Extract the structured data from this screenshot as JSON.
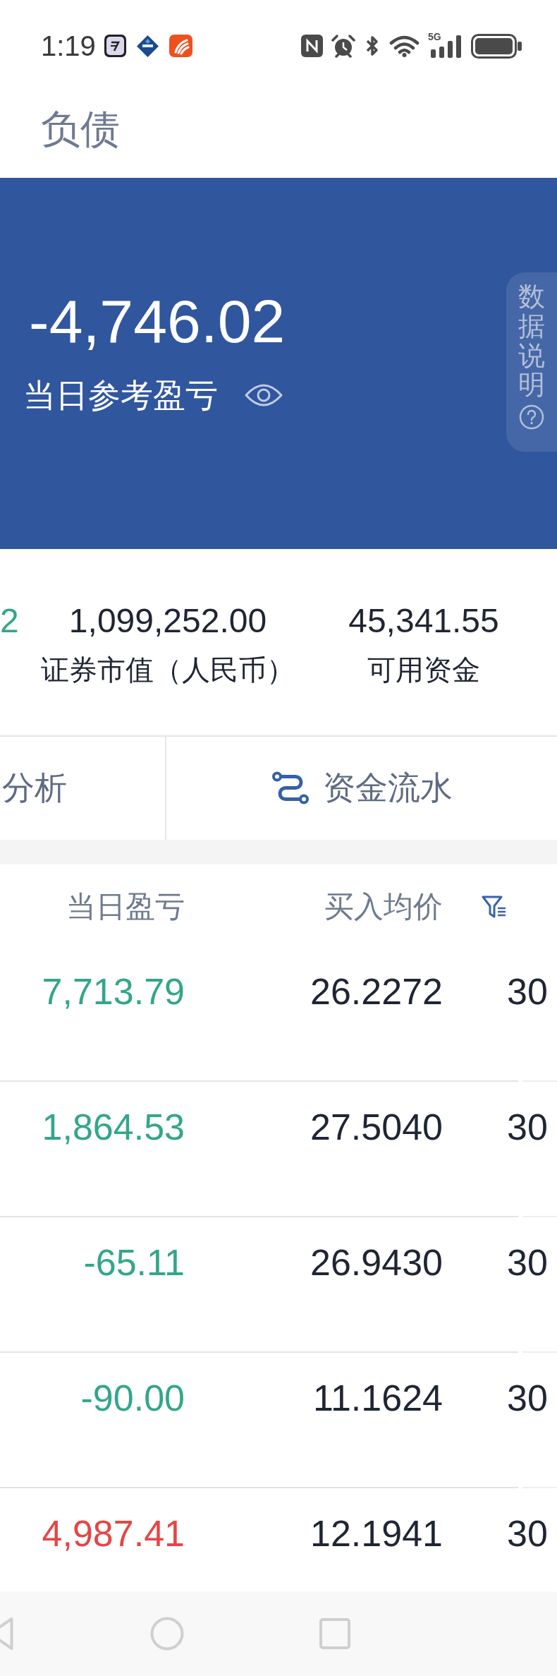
{
  "status_bar": {
    "time": "1:19",
    "network": "5G"
  },
  "header": {
    "title": "负债"
  },
  "summary": {
    "amount": "-4,746.02",
    "label": "当日参考盈亏",
    "info_tab": "数据说明"
  },
  "stats": [
    {
      "value": "2",
      "color": "#33a68a"
    },
    {
      "value": "1,099,252.00",
      "label": "证券市值（人民币）",
      "color": "#1f2533"
    },
    {
      "value": "45,341.55",
      "label": "可用资金",
      "color": "#1f2533"
    }
  ],
  "actions": [
    {
      "label": "分析",
      "kind": "plain"
    },
    {
      "label": "资金流水",
      "kind": "route"
    }
  ],
  "table": {
    "columns": [
      "当日盈亏",
      "买入均价"
    ],
    "rows": [
      {
        "pnl": "7,713.79",
        "color": "#33a68a",
        "avg_price": "26.2272",
        "column_3": "30"
      },
      {
        "pnl": "1,864.53",
        "color": "#33a68a",
        "avg_price": "27.5040",
        "column_3": "30"
      },
      {
        "pnl": "-65.11",
        "color": "#33a68a",
        "avg_price": "26.9430",
        "column_3": "30"
      },
      {
        "pnl": "-90.00",
        "color": "#33a68a",
        "avg_price": "11.1624",
        "column_3": "30"
      },
      {
        "pnl": "4,987.41",
        "color": "#e64545",
        "avg_price": "12.1941",
        "column_3": "30"
      }
    ]
  }
}
